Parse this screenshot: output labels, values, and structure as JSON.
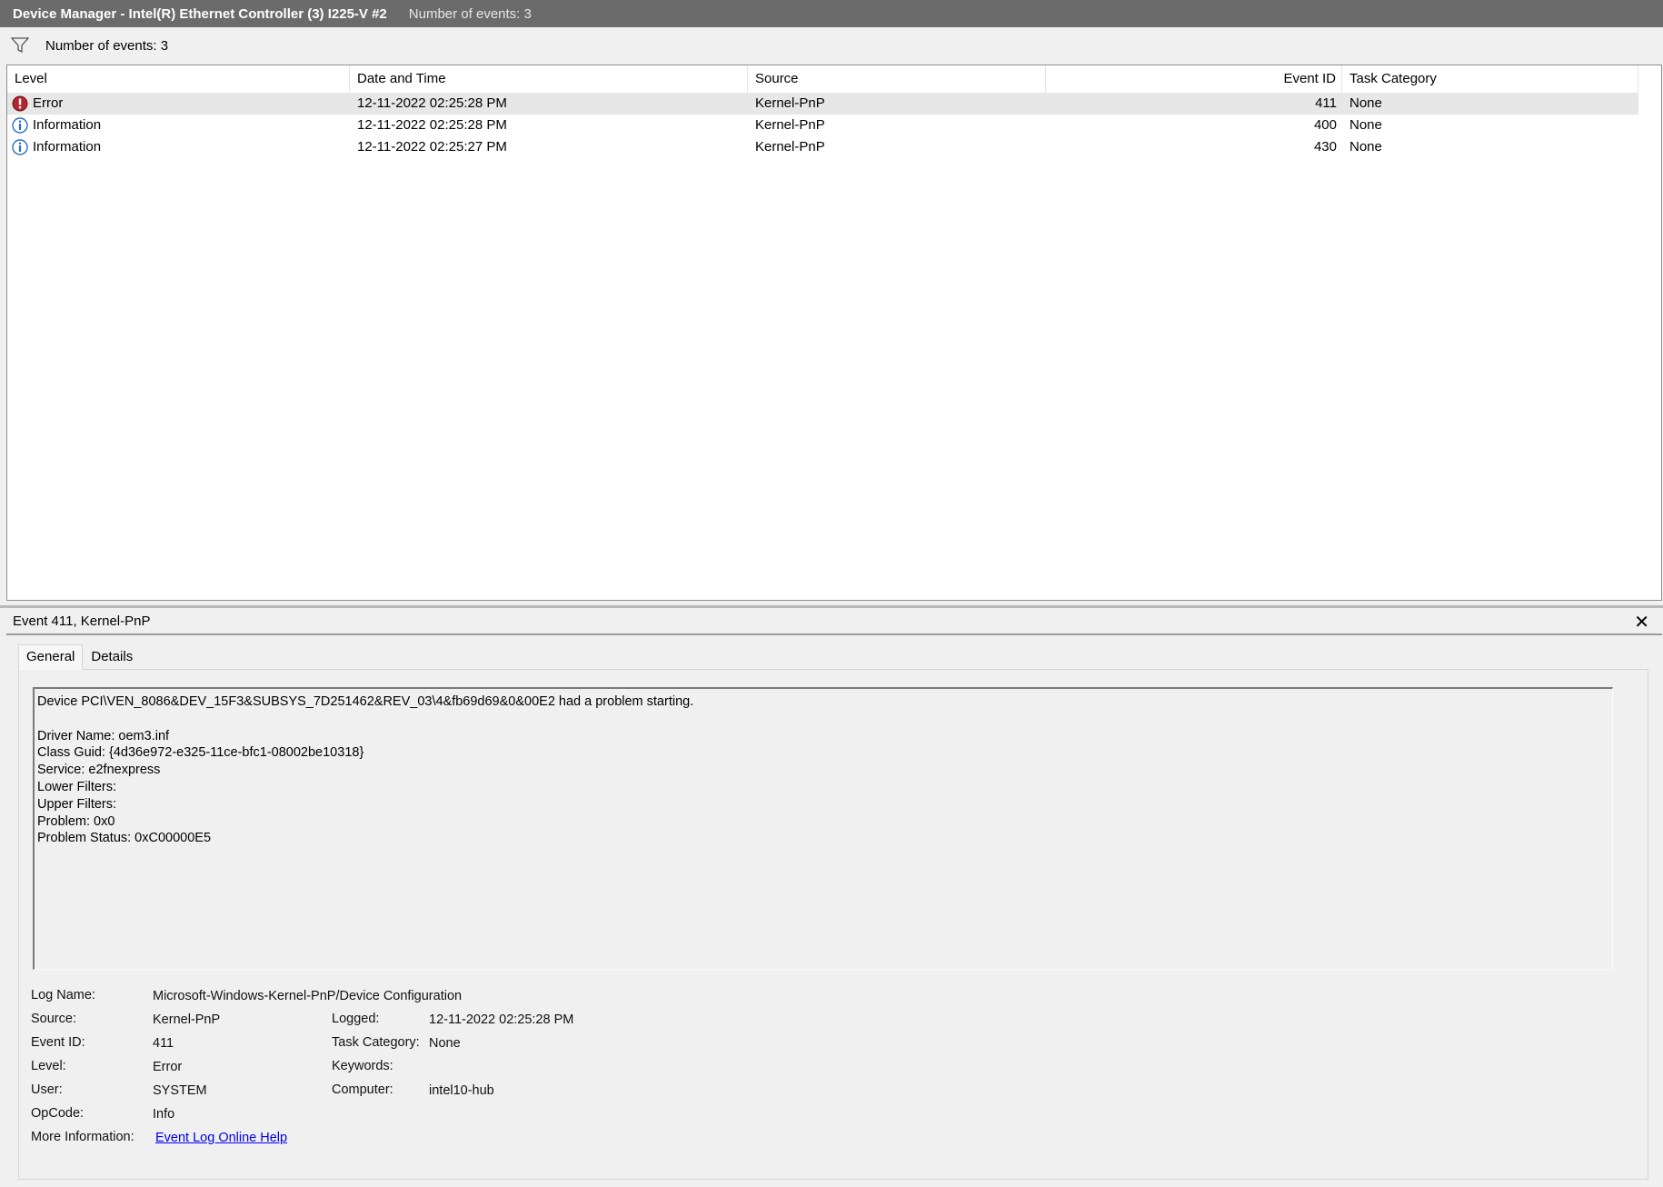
{
  "window": {
    "title": "Device Manager - Intel(R) Ethernet Controller (3) I225-V #2",
    "event_count": "Number of events: 3"
  },
  "filter": {
    "icon": "funnel-icon",
    "label": "Number of events: 3"
  },
  "table": {
    "columns": [
      "Level",
      "Date and Time",
      "Source",
      "Event ID",
      "Task Category"
    ],
    "rows": [
      {
        "icon": "error-icon",
        "level": "Error",
        "datetime": "12-11-2022 02:25:28 PM",
        "source": "Kernel-PnP",
        "event_id": "411",
        "category": "None",
        "selected": true
      },
      {
        "icon": "info-icon",
        "level": "Information",
        "datetime": "12-11-2022 02:25:28 PM",
        "source": "Kernel-PnP",
        "event_id": "400",
        "category": "None",
        "selected": false
      },
      {
        "icon": "info-icon",
        "level": "Information",
        "datetime": "12-11-2022 02:25:27 PM",
        "source": "Kernel-PnP",
        "event_id": "430",
        "category": "None",
        "selected": false
      }
    ]
  },
  "detail": {
    "title": "Event 411, Kernel-PnP",
    "close_glyph": "✕",
    "tabs": [
      "General",
      "Details"
    ],
    "active_tab": "General",
    "description": "Device PCI\\VEN_8086&DEV_15F3&SUBSYS_7D251462&REV_03\\4&fb69d69&0&00E2 had a problem starting.\n\nDriver Name: oem3.inf\nClass Guid: {4d36e972-e325-11ce-bfc1-08002be10318}\nService: e2fnexpress\nLower Filters: \nUpper Filters: \nProblem: 0x0\nProblem Status: 0xC00000E5",
    "props": {
      "log_name_label": "Log Name:",
      "log_name": "Microsoft-Windows-Kernel-PnP/Device Configuration",
      "source_label": "Source:",
      "source": "Kernel-PnP",
      "logged_label": "Logged:",
      "logged": "12-11-2022 02:25:28 PM",
      "event_id_label": "Event ID:",
      "event_id": "411",
      "task_category_label": "Task Category:",
      "task_category": "None",
      "level_label": "Level:",
      "level": "Error",
      "keywords_label": "Keywords:",
      "keywords": "",
      "user_label": "User:",
      "user": "SYSTEM",
      "computer_label": "Computer:",
      "computer": "intel10-hub",
      "opcode_label": "OpCode:",
      "opcode": "Info",
      "more_info_label": "More Information:",
      "more_info_link": "Event Log Online Help"
    }
  },
  "colors": {
    "titlebar": "#6b6b6b",
    "selected_row": "#e7e7e7",
    "error_icon": "#b3262e",
    "info_icon": "#2b6cc4",
    "link": "#0000ee"
  }
}
